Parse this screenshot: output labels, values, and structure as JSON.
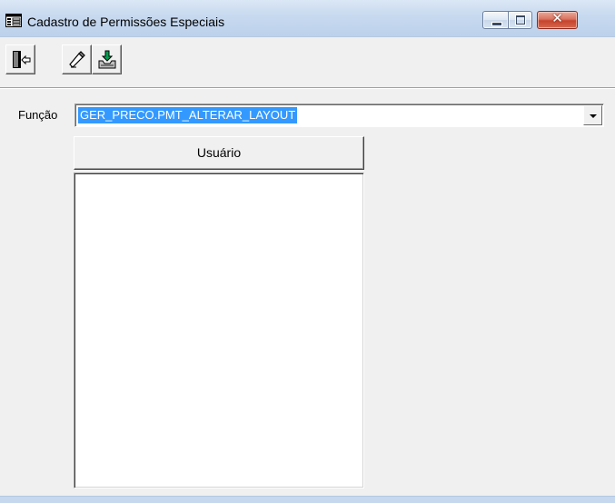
{
  "window": {
    "title": "Cadastro de Permissões Especiais",
    "icon": "form-icon",
    "controls": [
      "minimize-icon",
      "maximize-icon",
      "close-icon"
    ],
    "close_glyph": "✕"
  },
  "toolbar": {
    "buttons": [
      {
        "name": "exit-button",
        "icon": "door-exit-icon"
      },
      {
        "name": "clear-button",
        "icon": "eraser-icon"
      },
      {
        "name": "save-button",
        "icon": "save-to-tray-icon"
      }
    ]
  },
  "form": {
    "function_label": "Função",
    "function_value": "GER_PRECO.PMT_ALTERAR_LAYOUT",
    "selection_color": "#3399ff"
  },
  "user_list": {
    "header": "Usuário",
    "items": []
  },
  "colors": {
    "titlebar": "#c7d9ef",
    "close_button": "#c7432d",
    "window_bg": "#f0f0f0"
  }
}
